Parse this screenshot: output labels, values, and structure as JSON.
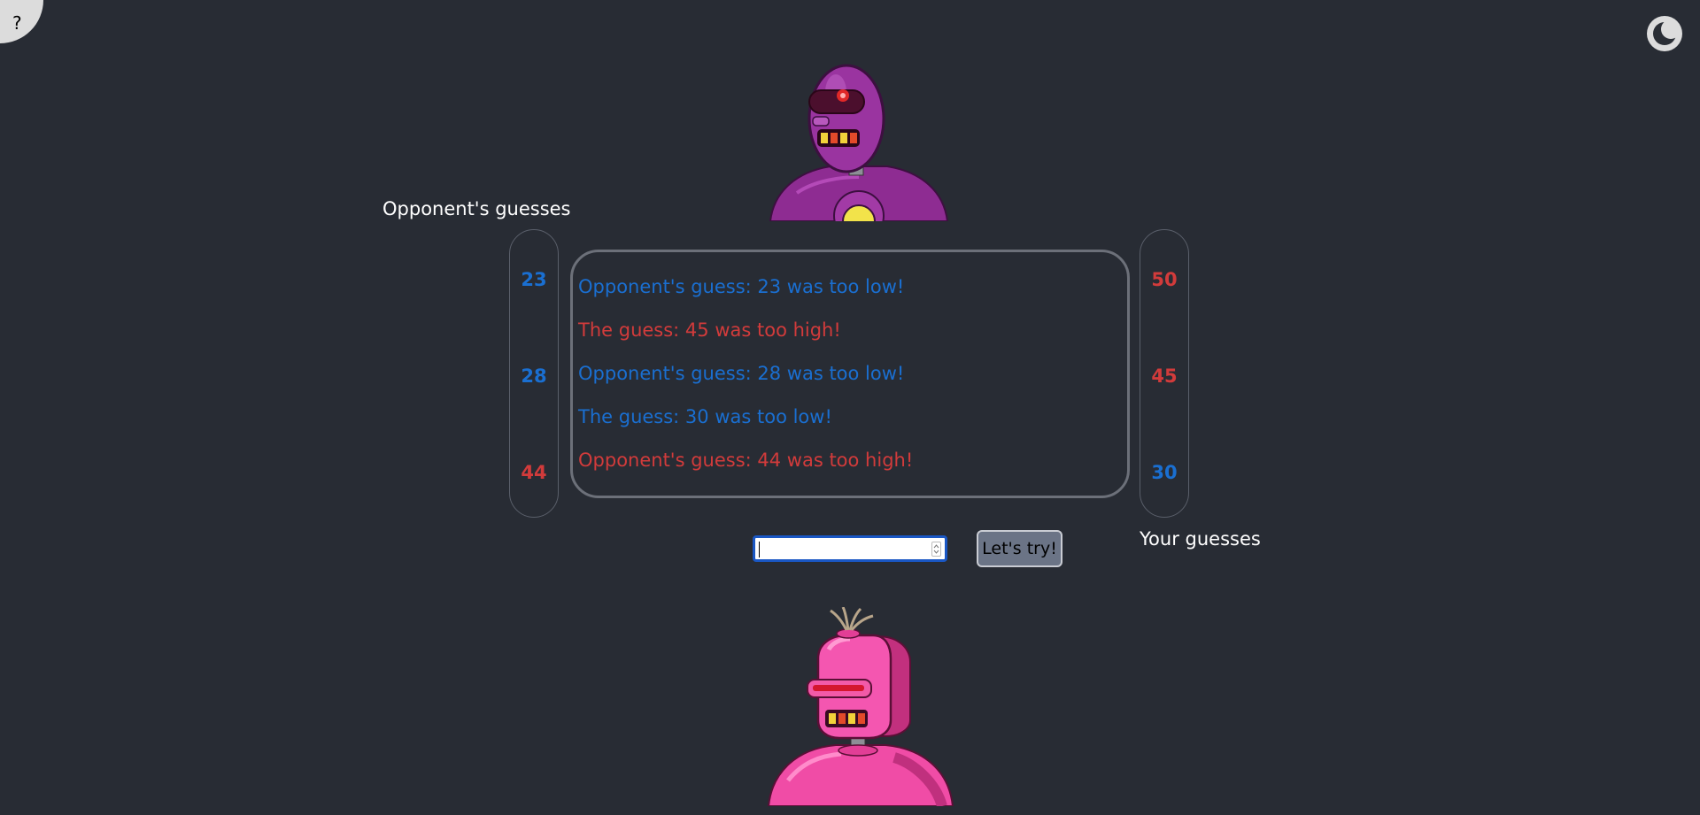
{
  "help": {
    "label": "?"
  },
  "theme_toggle": {
    "icon": "moon-icon"
  },
  "opponent_panel": {
    "title": "Opponent's guesses",
    "guesses": [
      {
        "value": "23",
        "status": "low"
      },
      {
        "value": "28",
        "status": "low"
      },
      {
        "value": "44",
        "status": "high"
      }
    ]
  },
  "player_panel": {
    "title": "Your guesses",
    "guesses": [
      {
        "value": "50",
        "status": "high"
      },
      {
        "value": "45",
        "status": "high"
      },
      {
        "value": "30",
        "status": "low"
      }
    ]
  },
  "log": [
    {
      "text": "Opponent's guess: 23 was too low!",
      "status": "low"
    },
    {
      "text": "The guess: 45 was too high!",
      "status": "high"
    },
    {
      "text": "Opponent's guess: 28 was too low!",
      "status": "low"
    },
    {
      "text": "The guess: 30 was too low!",
      "status": "low"
    },
    {
      "text": "Opponent's guess: 44 was too high!",
      "status": "high"
    }
  ],
  "guess_input": {
    "value": ""
  },
  "submit": {
    "label": "Let's try!"
  },
  "colors": {
    "low": "#1a6fd1",
    "high": "#d23b3b",
    "background": "#282c34"
  },
  "opponent_robot": {
    "icon": "purple-robot-icon"
  },
  "player_robot": {
    "icon": "pink-robot-icon"
  }
}
